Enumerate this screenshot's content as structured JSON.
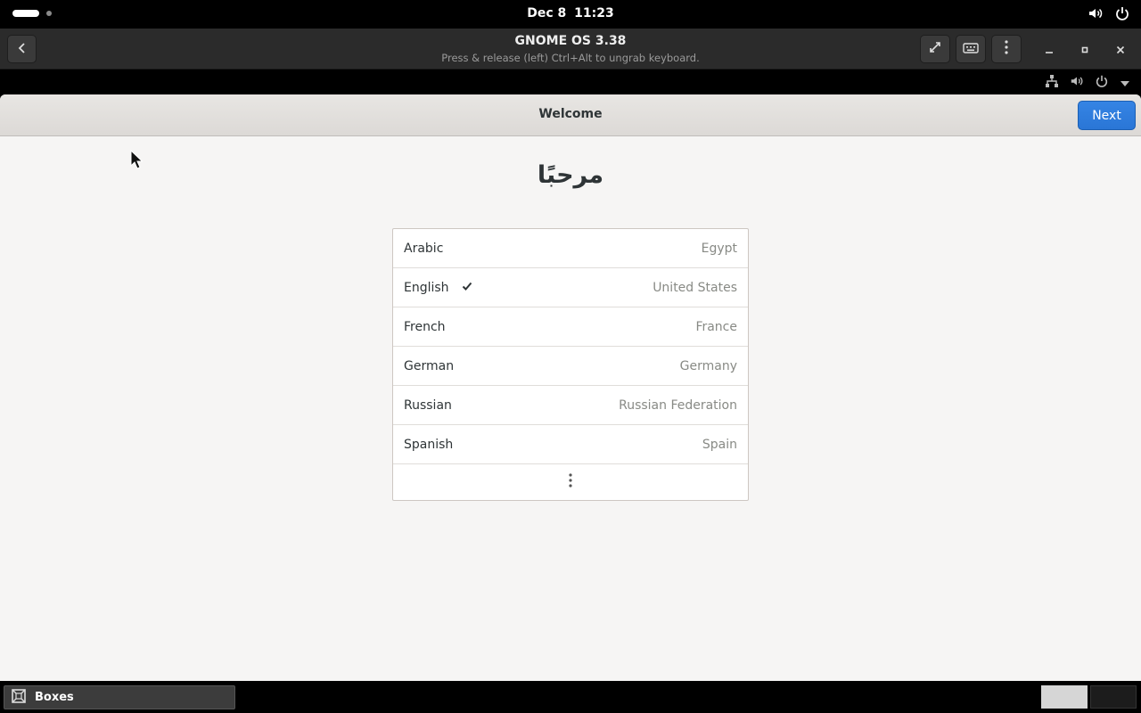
{
  "host_topbar": {
    "date": "Dec 8",
    "time": "11:23"
  },
  "boxes_header": {
    "title": "GNOME OS 3.38",
    "subtitle": "Press & release (left) Ctrl+Alt to ungrab keyboard."
  },
  "guest_window": {
    "title": "Welcome",
    "next_label": "Next",
    "welcome_text": "مرحبًا",
    "languages": [
      {
        "name": "Arabic",
        "region": "Egypt",
        "selected": false
      },
      {
        "name": "English",
        "region": "United States",
        "selected": true
      },
      {
        "name": "French",
        "region": "France",
        "selected": false
      },
      {
        "name": "German",
        "region": "Germany",
        "selected": false
      },
      {
        "name": "Russian",
        "region": "Russian Federation",
        "selected": false
      },
      {
        "name": "Spanish",
        "region": "Spain",
        "selected": false
      }
    ]
  },
  "taskbar": {
    "app_label": "Boxes"
  },
  "colors": {
    "accent": "#3584e4",
    "window_bg": "#f6f5f4"
  }
}
